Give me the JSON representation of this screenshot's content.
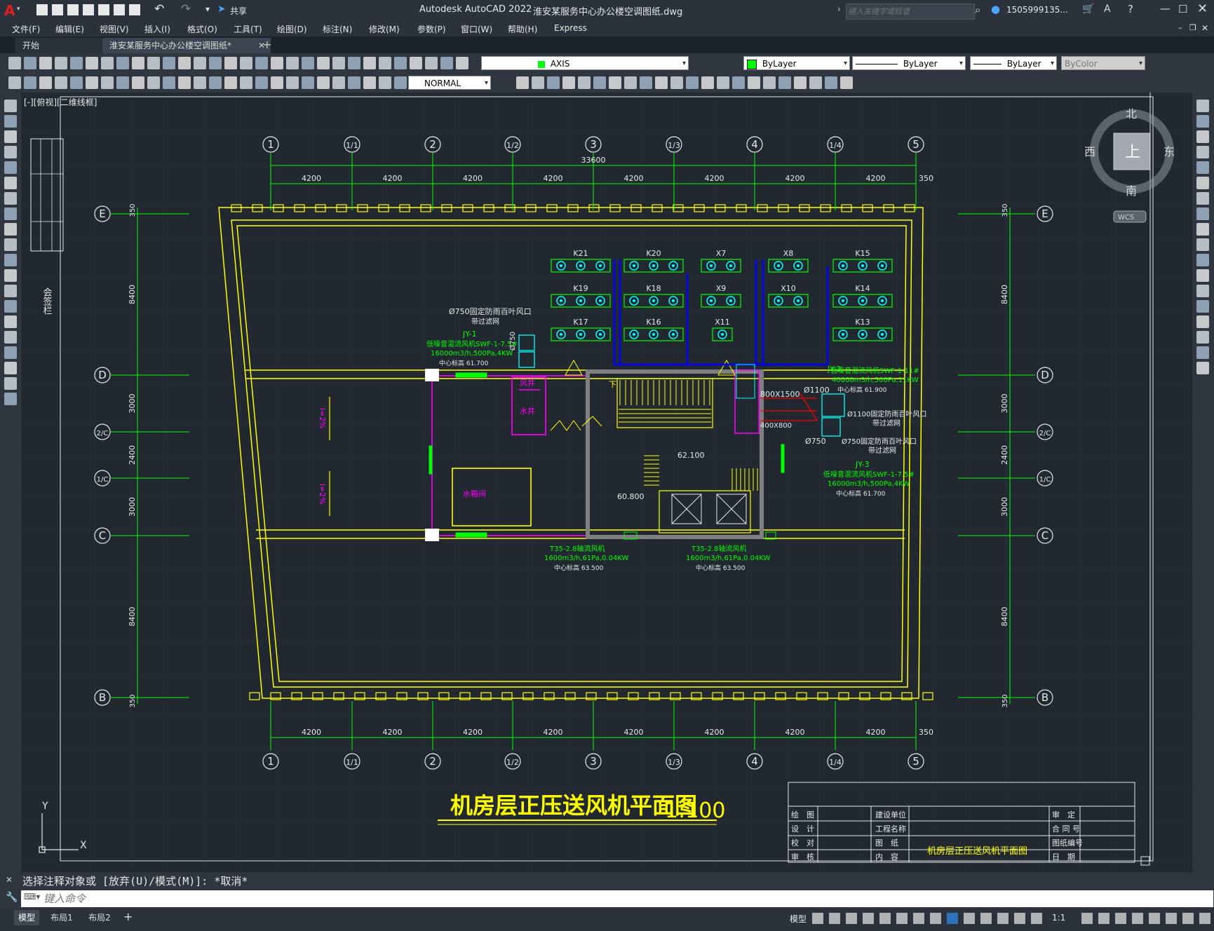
{
  "app": {
    "logo": "A",
    "title": "Autodesk AutoCAD 2022",
    "file_name": "淮安某服务中心办公楼空调图纸.dwg",
    "share_label": "共享",
    "search_placeholder": "键入关键字或短语",
    "user": "1505999135...",
    "window_controls": [
      "minimize-icon",
      "maximize-icon",
      "close-icon"
    ]
  },
  "menu": [
    "文件(F)",
    "编辑(E)",
    "视图(V)",
    "插入(I)",
    "格式(O)",
    "工具(T)",
    "绘图(D)",
    "标注(N)",
    "修改(M)",
    "参数(P)",
    "窗口(W)",
    "帮助(H)",
    "Express"
  ],
  "tabs": [
    {
      "label": "开始",
      "active": false
    },
    {
      "label": "淮安某服务中心办公楼空调图纸*",
      "active": true
    }
  ],
  "toolbar": {
    "layer_value": "AXIS",
    "color_value": "ByLayer",
    "linetype_value": "ByLayer",
    "lineweight_value": "ByLayer",
    "plotstyle_value": "ByColor",
    "text_style_value": "NORMAL"
  },
  "viewport": {
    "label": "[-][俯视][二维线框]"
  },
  "viewcube": {
    "north": "北",
    "south": "南",
    "east": "东",
    "west": "西",
    "top": "上",
    "wcs": "WCS"
  },
  "ucs": {
    "x": "X",
    "y": "Y"
  },
  "drawing": {
    "title": "机房层正压送风机平面图",
    "scale": "1:100",
    "overall_dim": "33600",
    "bay_dim": "4200",
    "edge_dim": "350",
    "axes_top": [
      "1",
      "1/1",
      "2",
      "1/2",
      "3",
      "1/3",
      "4",
      "1/4",
      "5"
    ],
    "axes_side": [
      "E",
      "D",
      "2/C",
      "1/C",
      "C",
      "B"
    ],
    "side_dims": [
      "8400",
      "3000",
      "2400",
      "3000",
      "8400"
    ],
    "edge_dim_v": "350",
    "units_row1": [
      "K21",
      "K20",
      "X7",
      "X8",
      "K15"
    ],
    "units_row2": [
      "K19",
      "K18",
      "X9",
      "X10",
      "K14"
    ],
    "units_row3": [
      "K17",
      "K16",
      "X11",
      "K13"
    ],
    "labels": {
      "jy1_name": "JY-1",
      "jy1_spec": "低噪音混流风机SWF-1-7.5#",
      "jy1_flow": "16000m3/h,500Pa,4KW",
      "jy1_elev": "中心标高 61.700",
      "louver1": "Ø750固定防雨百叶风口",
      "louver1b": "带过滤网",
      "d750": "Ø750",
      "jy2_name": "JY-2",
      "jy2_spec": "低噪音混流风机SWF-1-11#",
      "jy2_flow": "40000m3/h,500Pa,11KW",
      "jy2_elev": "中心标高 61.900",
      "d1100": "Ø1100",
      "louver2": "Ø1100固定防雨百叶风口",
      "louver2b": "带过滤网",
      "duct1": "800X1500",
      "duct2": "400X800",
      "d750b": "Ø750",
      "louver3": "Ø750固定防雨百叶风口",
      "louver3b": "带过滤网",
      "jy3_name": "JY-3",
      "jy3_spec": "低噪音混流风机SWF-1-7.5#",
      "jy3_flow": "16000m3/h,500Pa,4KW",
      "jy3_elev": "中心标高 61.700",
      "t35_a": "T35-2.8轴流风机",
      "t35_a_flow": "1600m3/h,61Pa,0.04KW",
      "t35_a_elev": "中心标高 63.500",
      "t35_b": "T35-2.8轴流风机",
      "t35_b_flow": "1600m3/h,61Pa,0.04KW",
      "t35_b_elev": "中心标高 63.500",
      "fengjing": "风井",
      "shuijing": "水井",
      "shuixiangjian": "水箱间",
      "elev1": "62.100",
      "elev2": "60.800",
      "slope": "i=2%",
      "stair_down": "下",
      "stamp": "会签栏"
    },
    "title_block": {
      "c1": [
        "绘　图",
        "设　计",
        "校　对",
        "审　核"
      ],
      "c2": [
        "建设单位",
        "工程名称",
        "图　纸",
        "内　容"
      ],
      "c3": [
        "审　定",
        "合 同 号",
        "图纸编号",
        "日　期"
      ],
      "content": "机房层正压送风机平面图"
    }
  },
  "command": {
    "history": "选择注释对象或 [放弃(U)/模式(M)]: *取消*",
    "placeholder": "键入命令"
  },
  "status": {
    "tabs": [
      "模型",
      "布局1",
      "布局2"
    ],
    "model_label": "模型",
    "scale": "1:1"
  },
  "colors": {
    "yellow": "#ffff00",
    "green": "#00ff00",
    "magenta": "#ff00ff",
    "cyan": "#00ffff",
    "blue": "#0000ff",
    "red": "#ff0000",
    "grey": "#808080",
    "bg": "#212830"
  }
}
